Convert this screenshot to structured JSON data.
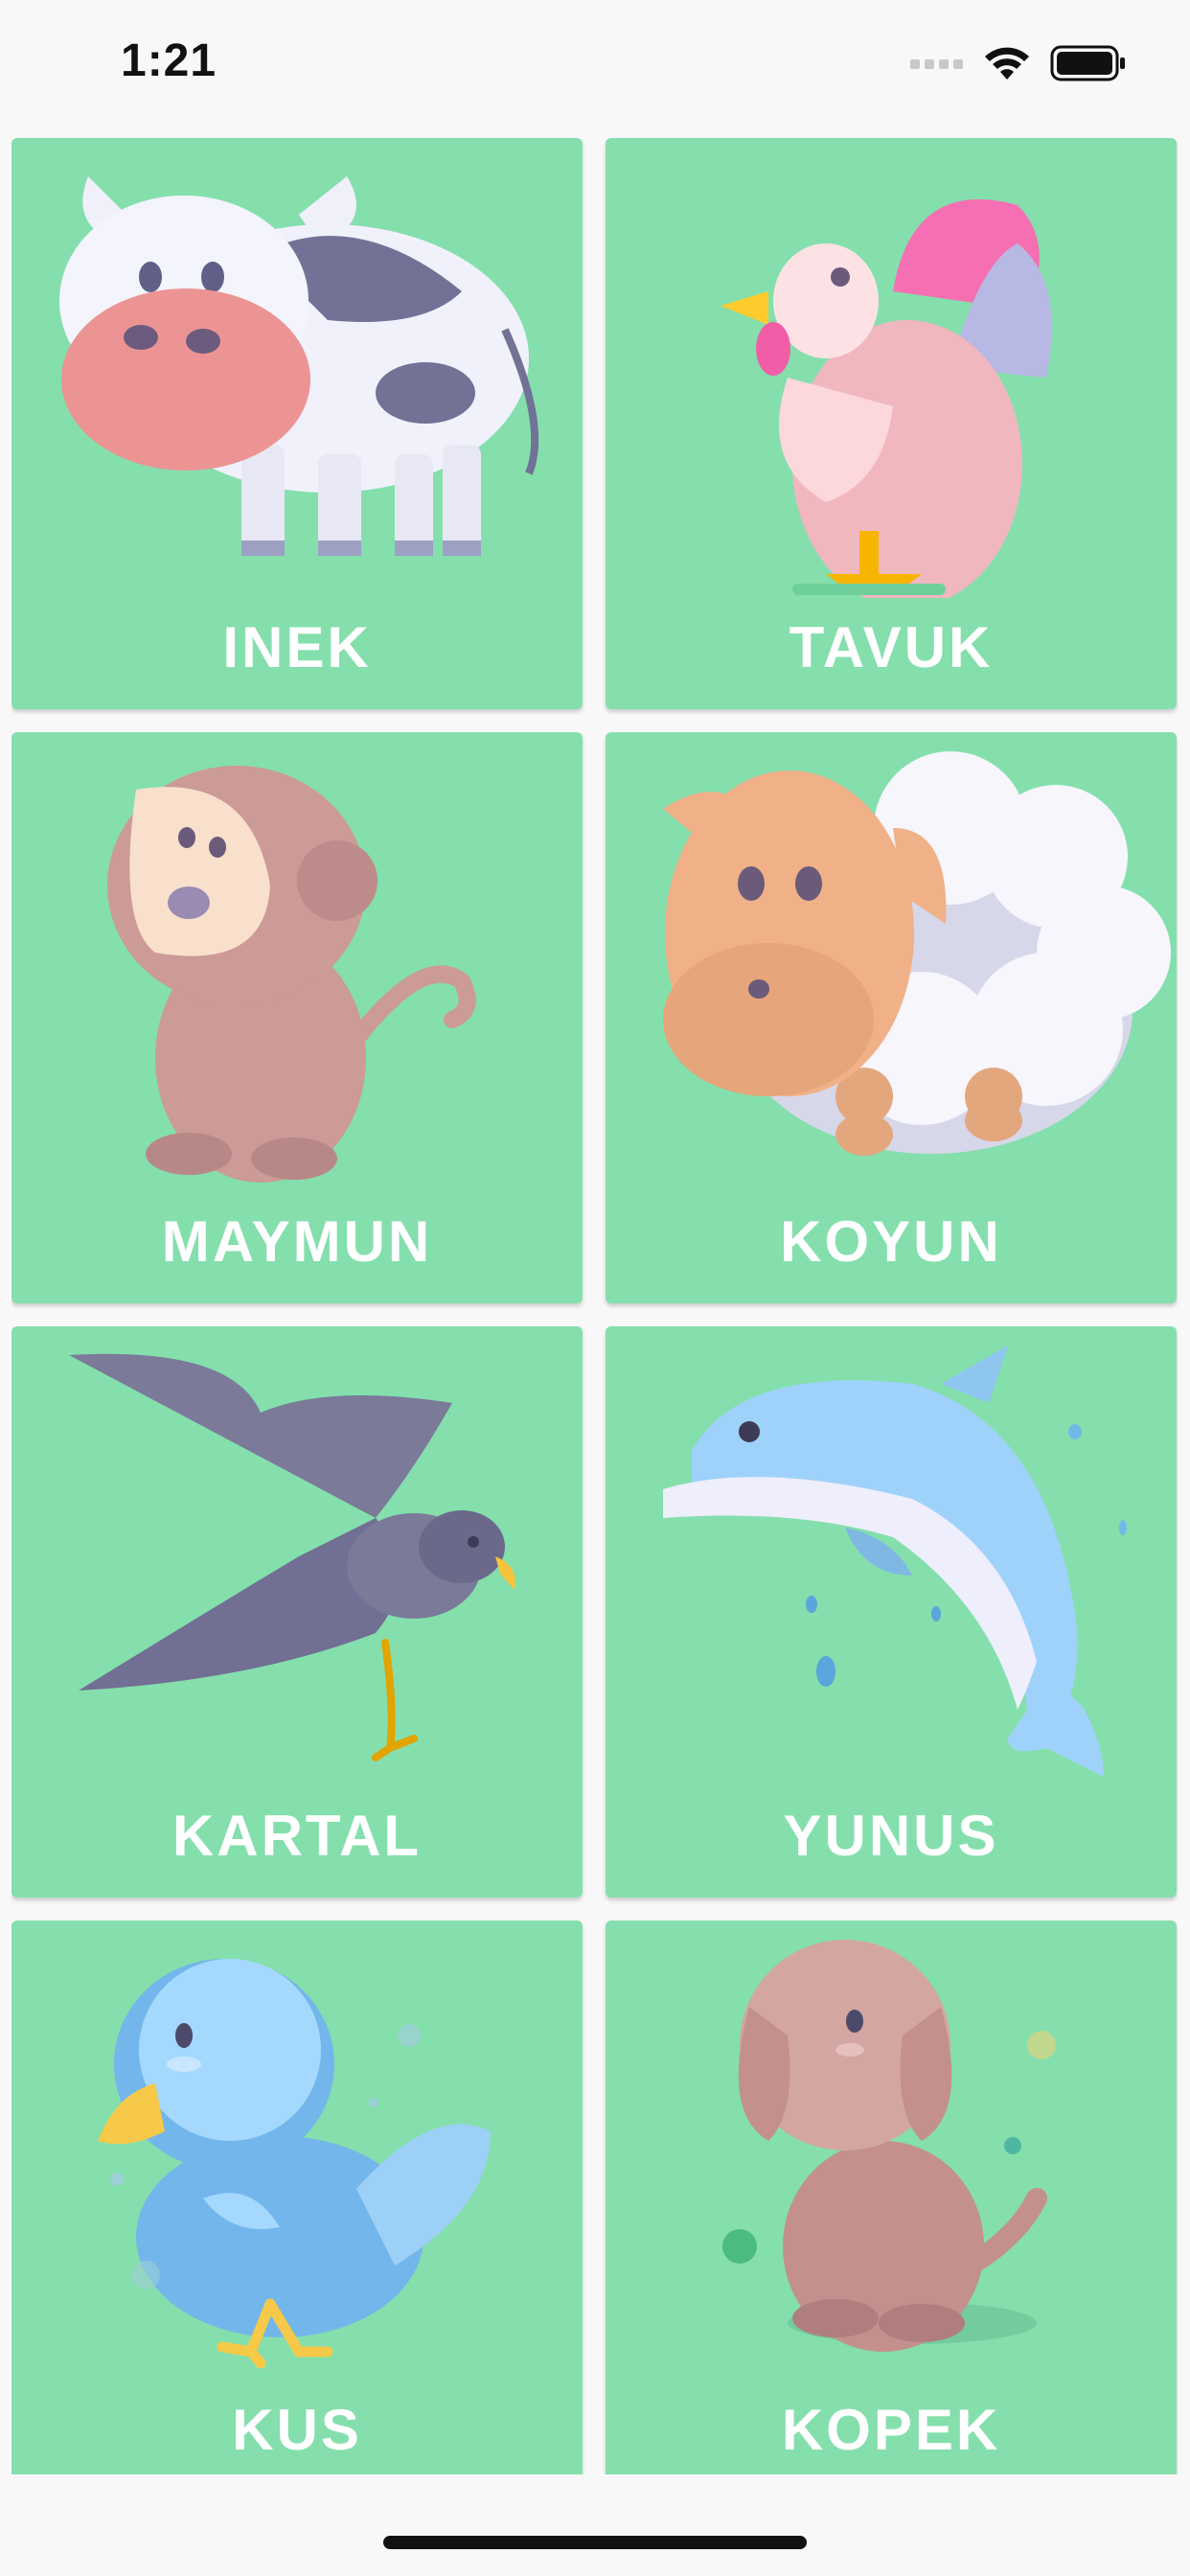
{
  "status_bar": {
    "time": "1:21"
  },
  "colors": {
    "card_background": "#84dfad",
    "label_color": "#ffffff",
    "page_background": "#f8f8f8"
  },
  "animals": [
    {
      "label": "INEK",
      "icon": "cow-icon"
    },
    {
      "label": "TAVUK",
      "icon": "rooster-icon"
    },
    {
      "label": "MAYMUN",
      "icon": "monkey-icon"
    },
    {
      "label": "KOYUN",
      "icon": "sheep-icon"
    },
    {
      "label": "KARTAL",
      "icon": "eagle-icon"
    },
    {
      "label": "YUNUS",
      "icon": "dolphin-icon"
    },
    {
      "label": "KUS",
      "icon": "bird-icon"
    },
    {
      "label": "KOPEK",
      "icon": "dog-icon"
    }
  ]
}
